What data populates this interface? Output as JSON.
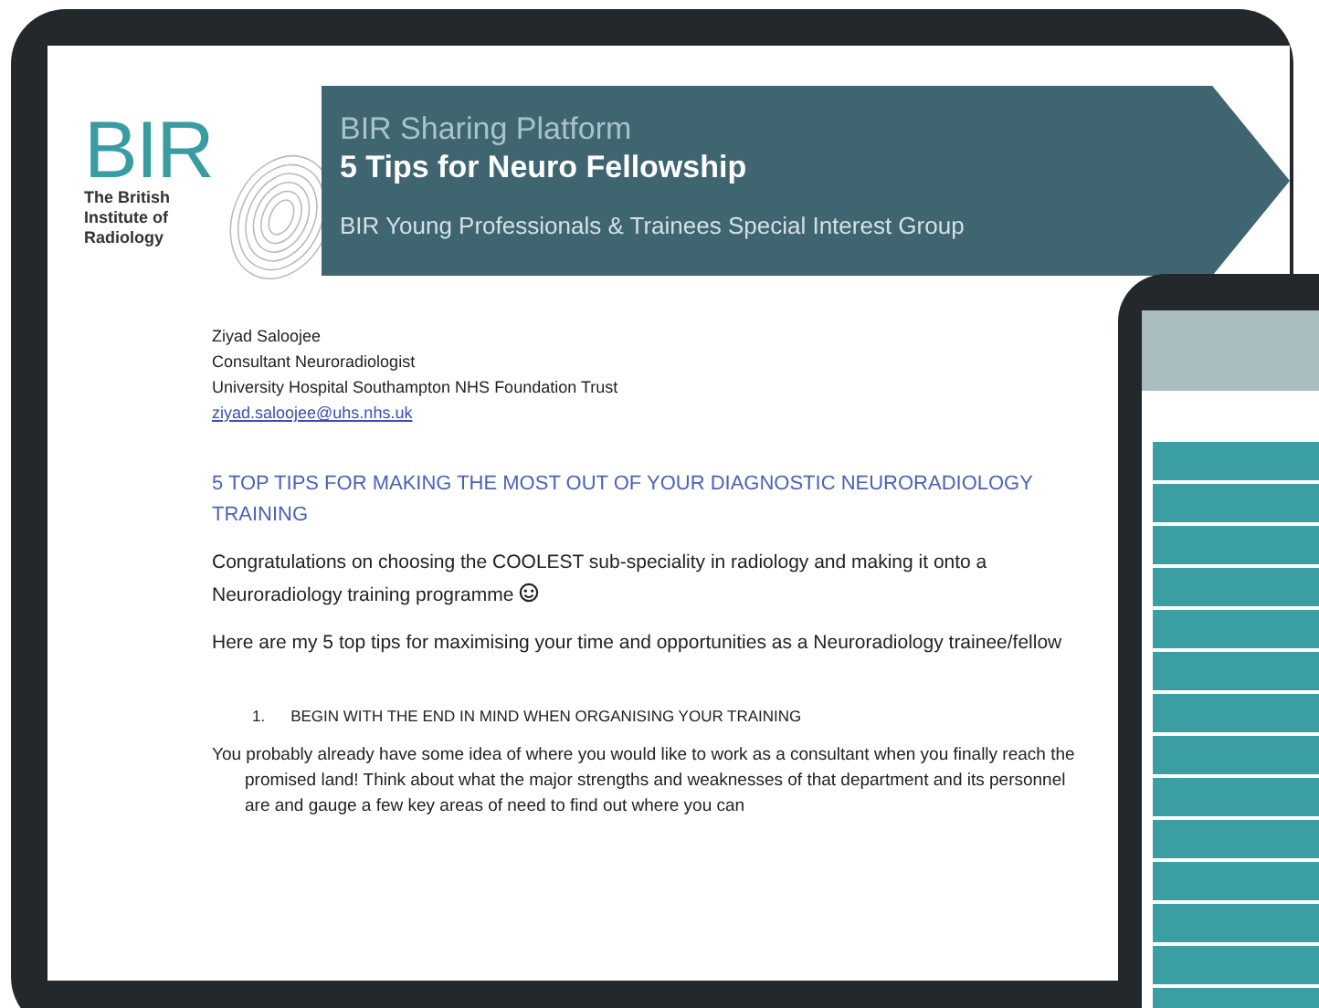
{
  "logo": {
    "mark": "BIR",
    "org_lines": [
      "The British",
      "Institute of",
      "Radiology"
    ]
  },
  "banner": {
    "kicker": "BIR Sharing Platform",
    "title": "5 Tips for Neuro Fellowship",
    "subtitle": "BIR Young Professionals & Trainees Special Interest Group"
  },
  "author": {
    "name": "Ziyad Saloojee",
    "role": "Consultant Neuroradiologist",
    "organisation": "University Hospital Southampton NHS Foundation Trust",
    "email": "ziyad.saloojee@uhs.nhs.uk"
  },
  "heading": "5 TOP TIPS FOR MAKING THE MOST OUT OF YOUR DIAGNOSTIC NEURORADIOLOGY TRAINING",
  "paragraphs": [
    {
      "text": "Congratulations on choosing the COOLEST sub-speciality in radiology and making it onto a Neuroradiology training programme",
      "emoji": true
    },
    {
      "text": "Here are my 5 top tips for maximising your time and opportunities as a Neuroradiology trainee/fellow",
      "emoji": false
    }
  ],
  "list_item": {
    "number": "1.",
    "text": "BEGIN WITH THE END IN MIND WHEN ORGANISING YOUR TRAINING"
  },
  "body": "You probably already have some idea of where you would like to work as a consultant when you finally reach the promised land! Think about what the major strengths and weaknesses of that department and its personnel are and gauge a few key areas of need to find out where you can"
}
